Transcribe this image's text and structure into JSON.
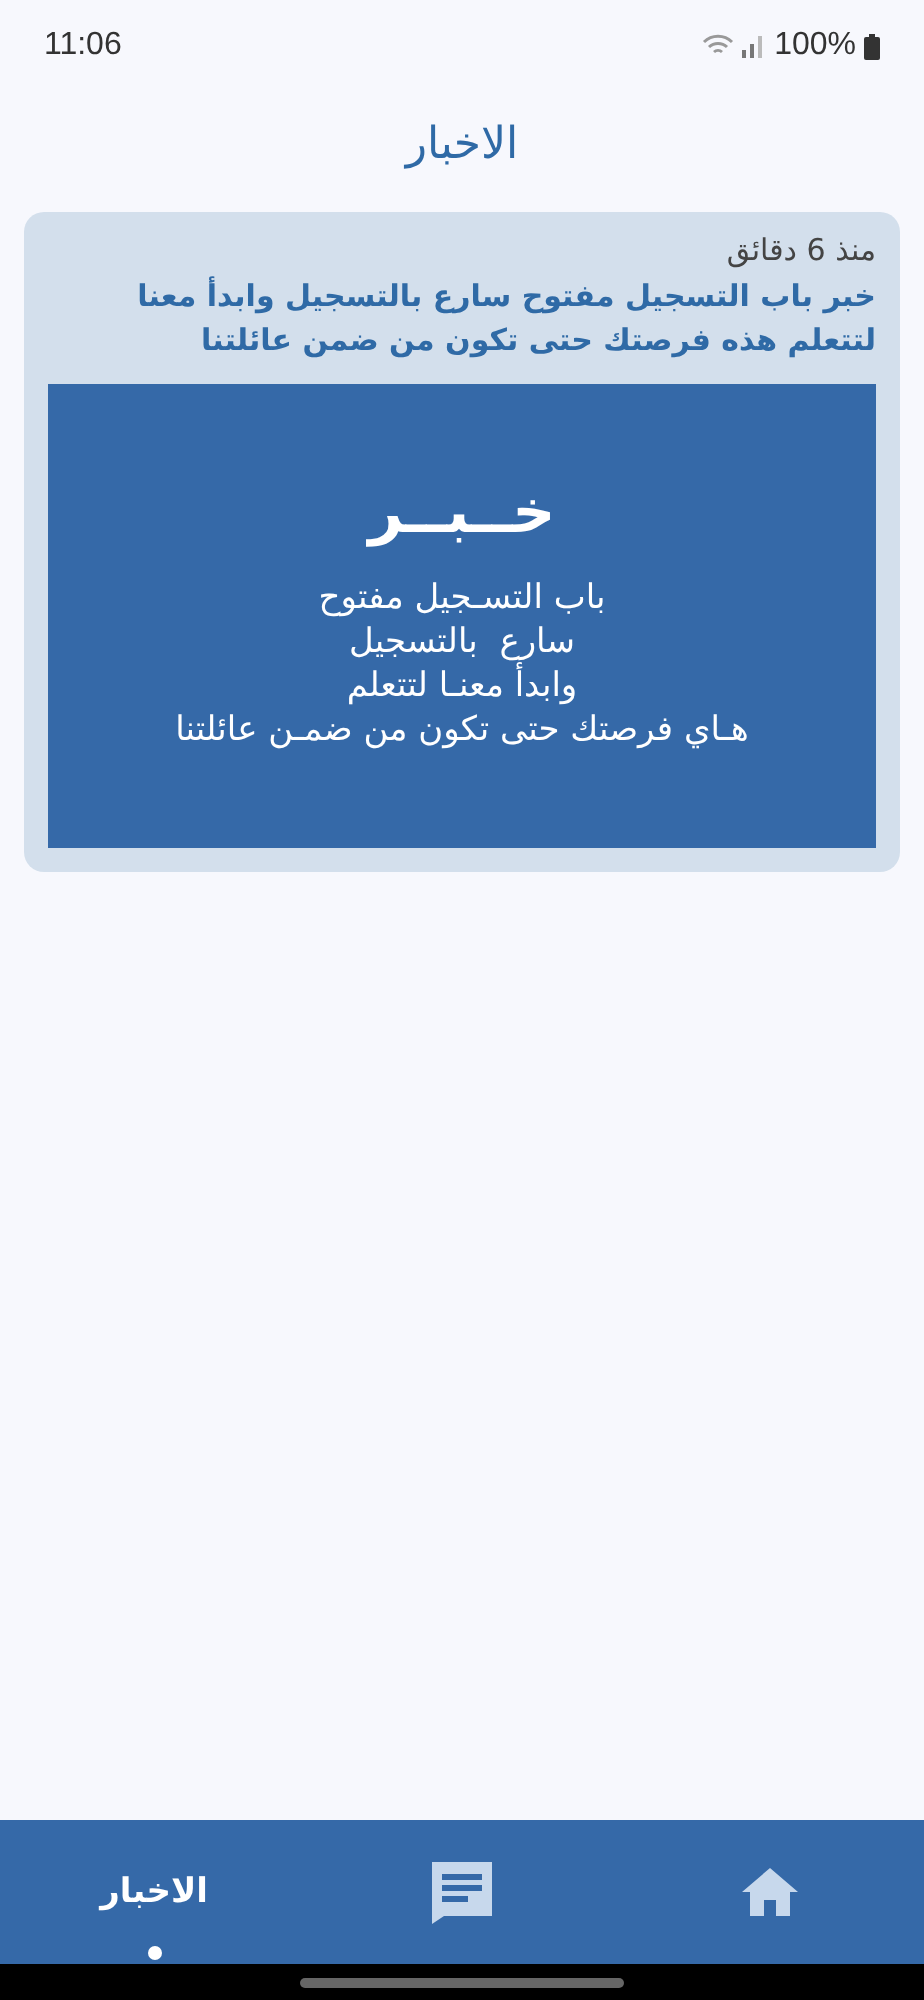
{
  "status_bar": {
    "time": "11:06",
    "battery": "100%"
  },
  "header": {
    "title": "الاخبار"
  },
  "news": [
    {
      "time": "منذ 6 دقائق",
      "title": "خبر باب التسجيل مفتوح سارع بالتسجيل وابدأ معنا لتتعلم هذه فرصتك حتى تكون من ضمن عائلتنا",
      "banner": {
        "heading": "خــبــر",
        "lines": [
          "باب التسـجيل مفتوح",
          "سارع  بالتسجيل",
          "وابدأ معنـا لتتعلم",
          "هـاي فرصتك حتى تكون من ضمـن عائلتنا"
        ]
      }
    }
  ],
  "bottom_nav": [
    {
      "kind": "home",
      "selected": false
    },
    {
      "kind": "chat",
      "selected": false
    },
    {
      "kind": "news",
      "label": "الاخبار",
      "selected": true
    }
  ]
}
